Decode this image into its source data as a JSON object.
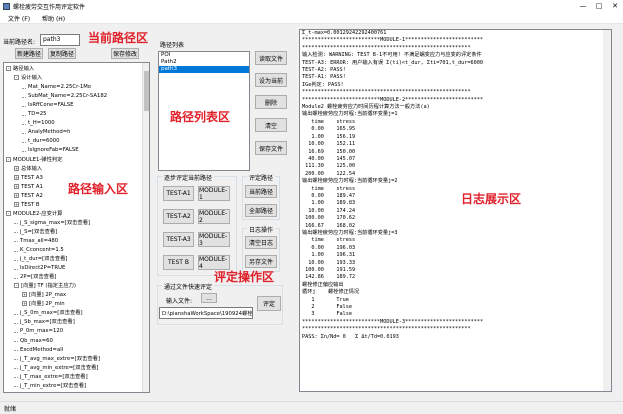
{
  "window": {
    "title": "螺栓疲劳交互作用评定软件"
  },
  "menu": [
    "文件 (F)",
    "帮助 (H)"
  ],
  "path_name": {
    "label": "当前路径名:",
    "value": "path3"
  },
  "path_buttons": [
    "新建路径",
    "复制路径",
    "保存修改"
  ],
  "annotations": {
    "current_path": "当前路径区",
    "path_input": "路径输入区",
    "path_list": "路径列表区",
    "eval_ops": "评定操作区",
    "log_display": "日志展示区"
  },
  "tree": [
    {
      "text": "路径输入",
      "level": 0,
      "exp": "-"
    },
    {
      "text": "设计输入",
      "level": 1,
      "exp": "-"
    },
    {
      "text": "Mat_Name=2.25Cr-1Mo",
      "level": 2,
      "exp": ""
    },
    {
      "text": "SubMat_Name=2.25Cr-SA182",
      "level": 2,
      "exp": ""
    },
    {
      "text": "IsRffCone=FALSE",
      "level": 2,
      "exp": ""
    },
    {
      "text": "TD=25",
      "level": 2,
      "exp": ""
    },
    {
      "text": "t_H=1000",
      "level": 2,
      "exp": ""
    },
    {
      "text": "AnalyMethod=h",
      "level": 2,
      "exp": ""
    },
    {
      "text": "t_dur=6000",
      "level": 2,
      "exp": ""
    },
    {
      "text": "IsIgnoreFab=FALSE",
      "level": 2,
      "exp": ""
    },
    {
      "text": "MODULE1-弹性判定",
      "level": 0,
      "exp": "-"
    },
    {
      "text": "总体输入",
      "level": 1,
      "exp": "+"
    },
    {
      "text": "TEST A3",
      "level": 1,
      "exp": "+"
    },
    {
      "text": "TEST A1",
      "level": 1,
      "exp": "+"
    },
    {
      "text": "TEST A2",
      "level": 1,
      "exp": "+"
    },
    {
      "text": "TEST B",
      "level": 1,
      "exp": "+"
    },
    {
      "text": "MODULE2-应变计算",
      "level": 0,
      "exp": "-"
    },
    {
      "text": "j_S_sigma_max=[双击查看]",
      "level": 1,
      "exp": ""
    },
    {
      "text": "j_S=[双击查看]",
      "level": 1,
      "exp": ""
    },
    {
      "text": "Tmax_all=480",
      "level": 1,
      "exp": ""
    },
    {
      "text": "K_Cconcent=1.5",
      "level": 1,
      "exp": ""
    },
    {
      "text": "j_t_dur=[双击查看]",
      "level": 1,
      "exp": ""
    },
    {
      "text": "IsDirect2P=TRUE",
      "level": 1,
      "exp": ""
    },
    {
      "text": "2P=[双击查看]",
      "level": 1,
      "exp": ""
    },
    {
      "text": "[向量] TF (指定主应力)",
      "level": 1,
      "exp": "-"
    },
    {
      "text": "[向量] 2P_max",
      "level": 2,
      "exp": "+"
    },
    {
      "text": "[向量] 2P_min",
      "level": 2,
      "exp": "+"
    },
    {
      "text": "j_S_0m_max=[双击查看]",
      "level": 1,
      "exp": ""
    },
    {
      "text": "j_Sb_max=[双击查看]",
      "level": 1,
      "exp": ""
    },
    {
      "text": "P_0m_max=120",
      "level": 1,
      "exp": ""
    },
    {
      "text": "Qb_max=60",
      "level": 1,
      "exp": ""
    },
    {
      "text": "ExcdMethod=all",
      "level": 1,
      "exp": ""
    },
    {
      "text": "j_T_avg_max_extre=[双击查看]",
      "level": 1,
      "exp": ""
    },
    {
      "text": "j_T_avg_min_extre=[双击查看]",
      "level": 1,
      "exp": ""
    },
    {
      "text": "j_T_max_extre=[双击查看]",
      "level": 1,
      "exp": ""
    },
    {
      "text": "j_T_min_extre=[双击查看]",
      "level": 1,
      "exp": ""
    }
  ],
  "path_list": {
    "label": "路径列表",
    "items": [
      "POI",
      "Path2",
      "path3"
    ],
    "selected": 2,
    "buttons": [
      "读取文件",
      "设为当前",
      "删除",
      "清空",
      "保存文件"
    ]
  },
  "step_eval": {
    "title": "逐步评定当前路径",
    "buttons": [
      "TEST-A1",
      "MODULE-1",
      "TEST-A2",
      "MODULE-2",
      "TEST-A3",
      "MODULE-3",
      "TEST B",
      "MODULE-4"
    ]
  },
  "eval_path": {
    "title": "评定路径",
    "buttons": [
      "当前路径",
      "全部路径"
    ]
  },
  "log_ops": {
    "title": "日志操作",
    "buttons": [
      "清空日志",
      "另存文件"
    ]
  },
  "file_eval": {
    "title": "通过文件快速评定",
    "label": "输入文件:",
    "browse": "...",
    "path": "D:\\pianshaWorkSpace\\190924螺栓",
    "eval": "评定"
  },
  "log_lines": [
    "Σ_t-max=0.00129242292400761",
    "",
    "*************************MODULE-1*************************",
    "******************************************************",
    "输入检测: WARNING: TEST B-1不可用! 不满足蠕变应力与应变的评定条件",
    "TEST-A3: ERROR: 用户输入有误 Σ(ti)<t_dur, Σti=701,t_dur=6000",
    "TEST-A2: PASS!",
    "TEST-A1: PASS!",
    "IGe判定: PASS!",
    "******************************************************",
    "*************************MODULE-2*************************",
    "Module2 螺栓疲劳应力时间历程计算方法一般方法(a)",
    "",
    "输出螺栓疲劳应力时程:当前循环变量j=1",
    "   time    stress",
    "   0.00    165.95",
    "   1.00    156.19",
    "  10.00    152.11",
    "  16.69    150.00",
    "  40.00    145.07",
    " 111.30    125.00",
    " 200.00    122.54",
    "",
    "输出螺栓疲劳应力时程:当前循环变量j=2",
    "   time    stress",
    "   0.00    189.47",
    "   1.00    189.83",
    "  10.00    174.24",
    " 100.00    170.62",
    " 166.67    168.02",
    "",
    "输出螺栓疲劳应力时程:当前循环变量j=3",
    "   time    stress",
    "   0.00    196.03",
    "   1.00    196.31",
    "  10.00    193.33",
    " 100.00    191.59",
    " 142.86    189.72",
    "",
    "螺栓修正偏应输出",
    "循环j    螺栓修正情况",
    "   1       True",
    "   2       False",
    "   3       False",
    "",
    "*************************MODULE-3*************************",
    "******************************************************",
    "PASS: Σn/Nd= 0   Σ Δt/Td=0.0193"
  ],
  "status": "就绪"
}
